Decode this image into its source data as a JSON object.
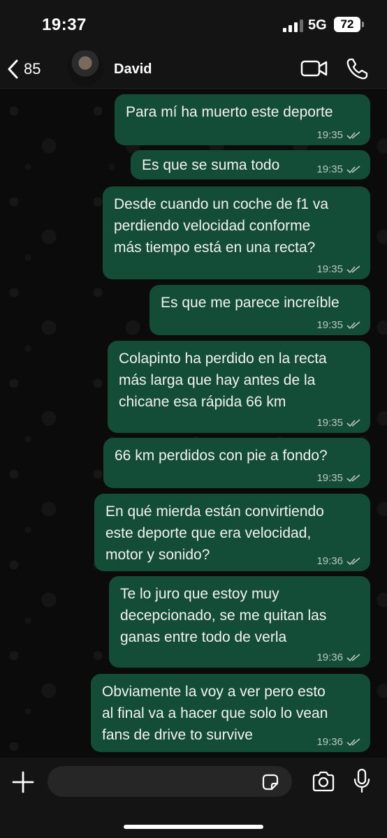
{
  "status_bar": {
    "time": "19:37",
    "network": "5G",
    "battery": "72"
  },
  "header": {
    "back_count": "85",
    "contact_name": "David"
  },
  "messages": [
    {
      "text": "Para mí ha muerto este deporte",
      "time": "19:35"
    },
    {
      "text": "Es que se suma todo",
      "time": "19:35"
    },
    {
      "text": "Desde cuando un coche de f1 va\nperdiendo velocidad conforme\nmás tiempo está en una recta?",
      "time": "19:35"
    },
    {
      "text": "Es que me parece increíble",
      "time": "19:35"
    },
    {
      "text": "Colapinto ha perdido en la recta\nmás larga que hay antes de la\nchicane esa rápida 66 km",
      "time": "19:35"
    },
    {
      "text": "66 km perdidos con pie a fondo?",
      "time": "19:35"
    },
    {
      "text": "En qué mierda están convirtiendo\neste deporte que era velocidad,\nmotor y sonido?",
      "time": "19:36"
    },
    {
      "text": "Te lo juro que estoy muy\ndecepcionado, se me quitan las\nganas entre todo de verla",
      "time": "19:36"
    },
    {
      "text": "Obviamente la voy a ver pero esto\nal final va a hacer que solo lo vean\nfans de drive to survive",
      "time": "19:36"
    }
  ],
  "input": {
    "value": "",
    "placeholder": ""
  },
  "colors": {
    "bubble": "#144d37",
    "background": "#0b0b0b",
    "bar": "#141414"
  },
  "icons": [
    "back-chevron-icon",
    "video-call-icon",
    "phone-icon",
    "plus-icon",
    "sticker-icon",
    "camera-icon",
    "microphone-icon",
    "double-check-icon"
  ]
}
